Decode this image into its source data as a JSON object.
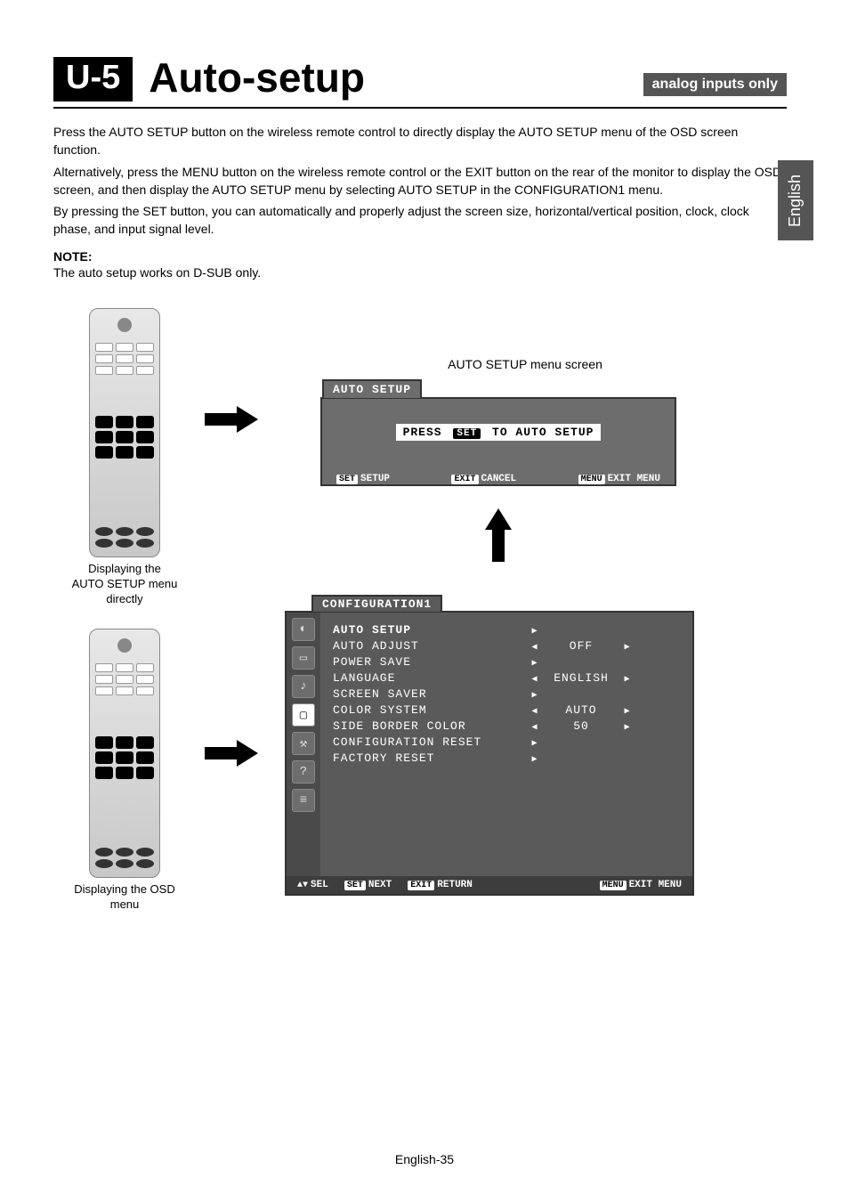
{
  "side_tab": "English",
  "header": {
    "badge": "U-5",
    "title": "Auto-setup",
    "pill": "analog inputs only"
  },
  "paragraphs": {
    "p1": "Press the AUTO SETUP button on the wireless remote control to directly display the AUTO SETUP menu of the OSD screen function.",
    "p2": "Alternatively, press the MENU button on the wireless remote control or the EXIT button on the rear of the monitor to display the OSD screen, and then display the AUTO SETUP menu by selecting AUTO SETUP in the CONFIGURATION1 menu.",
    "p3": "By pressing the SET button, you can automatically and properly adjust the screen size, horizontal/vertical position, clock, clock phase, and input signal level.",
    "note_label": "NOTE:",
    "note_text": "The auto setup works on D-SUB only."
  },
  "captions": {
    "remote1": "Displaying the AUTO SETUP menu directly",
    "remote2": "Displaying the OSD menu",
    "osd1_title": "AUTO SETUP menu screen"
  },
  "osd_auto": {
    "tab": "AUTO SETUP",
    "press_left": "PRESS",
    "press_key": "SET",
    "press_right": "TO AUTO SETUP",
    "foot_set_k": "SET",
    "foot_set": "SETUP",
    "foot_exit_k": "EXIT",
    "foot_exit": "CANCEL",
    "foot_menu_k": "MENU",
    "foot_menu": "EXIT MENU"
  },
  "osd_cfg": {
    "tab": "CONFIGURATION1",
    "rows": [
      {
        "name": "AUTO SETUP",
        "left": "",
        "val": "",
        "right": "single"
      },
      {
        "name": "AUTO ADJUST",
        "left": "l",
        "val": "OFF",
        "right": "r"
      },
      {
        "name": "POWER SAVE",
        "left": "",
        "val": "",
        "right": "single"
      },
      {
        "name": "LANGUAGE",
        "left": "l",
        "val": "ENGLISH",
        "right": "r"
      },
      {
        "name": "SCREEN SAVER",
        "left": "",
        "val": "",
        "right": "single"
      },
      {
        "name": "COLOR SYSTEM",
        "left": "l",
        "val": "AUTO",
        "right": "r"
      },
      {
        "name": "SIDE BORDER COLOR",
        "left": "l",
        "val": "50",
        "right": "r"
      },
      {
        "name": "CONFIGURATION RESET",
        "left": "",
        "val": "",
        "right": "single"
      },
      {
        "name": "FACTORY RESET",
        "left": "",
        "val": "",
        "right": "single"
      }
    ],
    "foot_sel": "SEL",
    "foot_set_k": "SET",
    "foot_set": "NEXT",
    "foot_exit_k": "EXIT",
    "foot_exit": "RETURN",
    "foot_menu_k": "MENU",
    "foot_menu": "EXIT MENU"
  },
  "page_number": "English-35"
}
